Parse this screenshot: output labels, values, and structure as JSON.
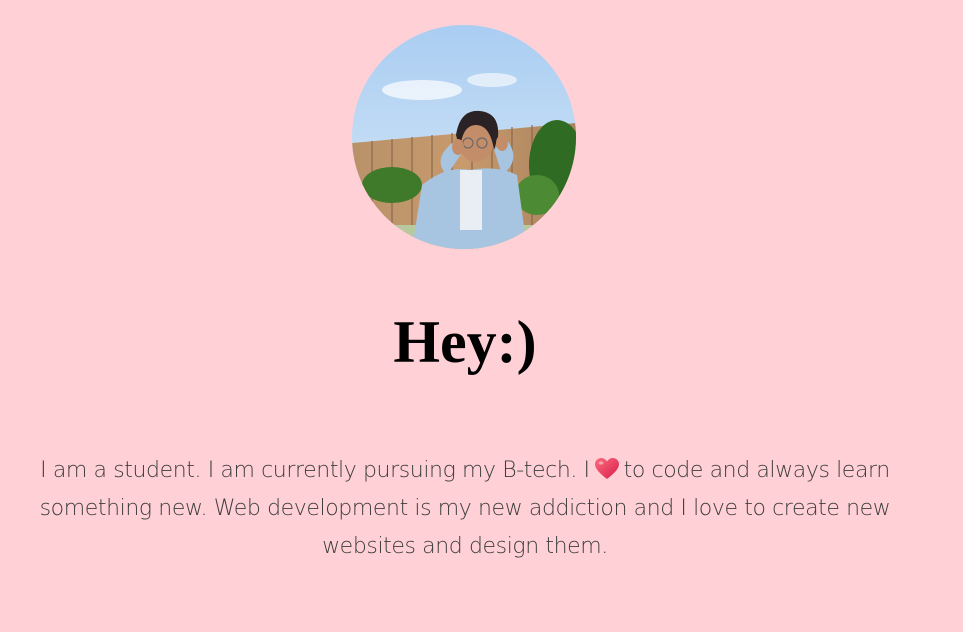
{
  "greeting": {
    "heading": "Hey:)"
  },
  "intro": {
    "part1": "I am a student. I am currently pursuing my B-tech. I",
    "icon": "heart-icon",
    "part2": "to code and always learn something new. Web development is my new addiction and I love to create new websites and design them."
  },
  "colors": {
    "background": "#ffd1d6",
    "heading": "#000000",
    "text": "#3d3d3d",
    "heart": "#e8305a"
  }
}
